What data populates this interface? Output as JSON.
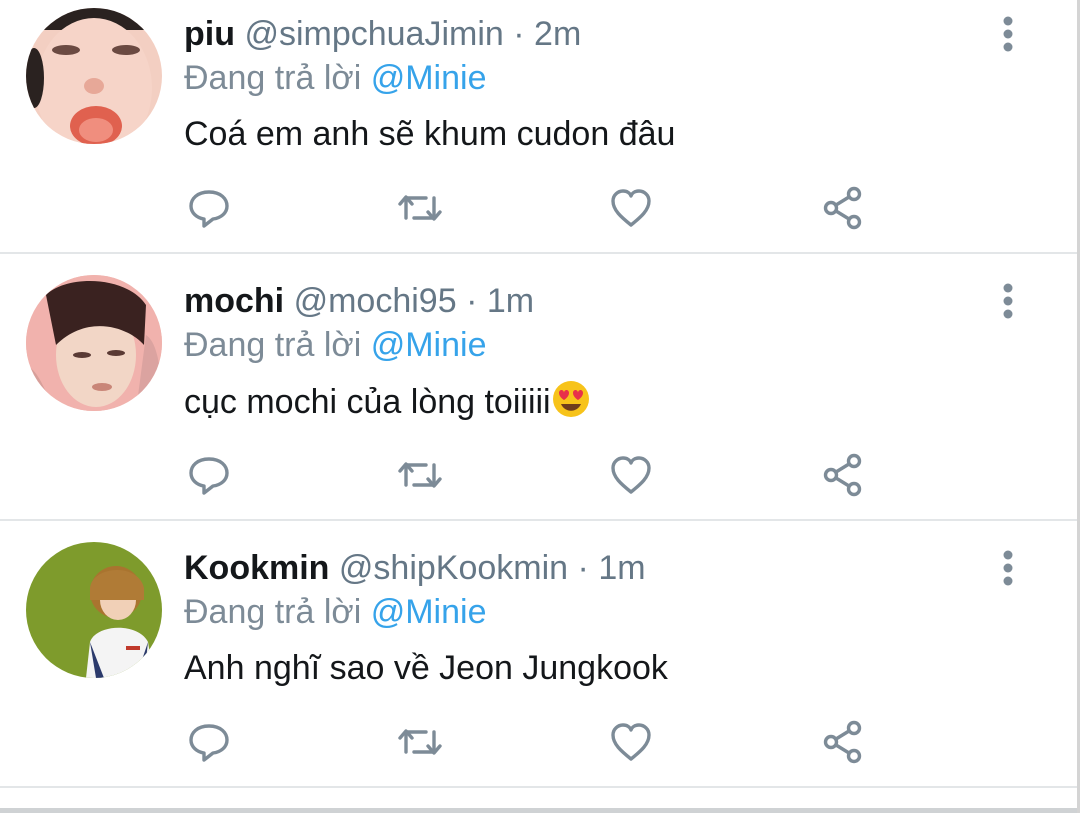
{
  "replies": [
    {
      "name": "piu",
      "handle": "@simpchuaJimin",
      "separator": "·",
      "time": "2m",
      "replying_prefix": "Đang trả lời",
      "replying_to": "@Minie",
      "text": "Coá em anh sẽ khum cudon đâu"
    },
    {
      "name": "mochi",
      "handle": "@mochi95",
      "separator": "·",
      "time": "1m",
      "replying_prefix": "Đang trả lời",
      "replying_to": "@Minie",
      "text": "cục mochi của lòng toiiiii",
      "emoji": "heart-eyes-emoji"
    },
    {
      "name": "Kookmin",
      "handle": "@shipKookmin",
      "separator": "·",
      "time": "1m",
      "replying_prefix": "Đang trả lời",
      "replying_to": "@Minie",
      "text": "Anh nghĩ sao về Jeon Jungkook"
    }
  ],
  "actions": [
    "reply-icon",
    "retweet-icon",
    "like-icon",
    "share-icon"
  ],
  "colors": {
    "name": "#14171a",
    "meta": "#657786",
    "mention": "#36a3ea",
    "icon": "#7d8b97",
    "divider": "#e3e6e8"
  }
}
